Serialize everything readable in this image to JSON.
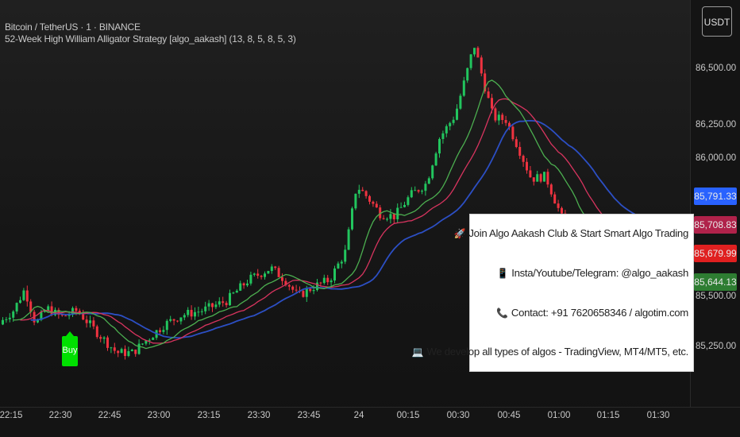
{
  "header": {
    "symbol_line": "Bitcoin / TetherUS · 1 · BINANCE",
    "indicator_line": "52-Week High William Alligator Strategy [algo_aakash] (13, 8, 5, 8, 5, 3)"
  },
  "currency_button": "USDT",
  "price_axis": {
    "labels": [
      "86,500.00",
      "86,250.00",
      "86,000.00",
      "85,500.00",
      "85,250.00"
    ],
    "badges": [
      {
        "text": "85,791.33",
        "color": "#2962ff"
      },
      {
        "text": "85,708.83",
        "color": "#b0224a"
      },
      {
        "text": "85,679.99",
        "color": "#e02020"
      },
      {
        "text": "85,644.13",
        "color": "#2e7d32"
      }
    ]
  },
  "time_axis": {
    "labels": [
      "22:15",
      "22:30",
      "22:45",
      "23:00",
      "23:15",
      "23:30",
      "23:45",
      "24",
      "00:15",
      "00:30",
      "00:45",
      "01:00",
      "01:15",
      "01:30"
    ]
  },
  "info_box": {
    "lines": [
      {
        "icon": "rocket-icon",
        "glyph": "🚀",
        "text": "Join Algo Aakash Club & Start Smart Algo Trading"
      },
      {
        "icon": "phone-icon",
        "glyph": "📱",
        "text": "Insta/Youtube/Telegram: @algo_aakash"
      },
      {
        "icon": "telephone-icon",
        "glyph": "📞",
        "text": "Contact: +91 7620658346 / algotim.com"
      },
      {
        "icon": "computer-icon",
        "glyph": "💻",
        "text": "We develop all types of algos - TradingView, MT4/MT5, etc."
      }
    ]
  },
  "buy_marker": {
    "text": "Buy",
    "color": "#00e000"
  },
  "chart_data": {
    "type": "candlestick",
    "ylim": [
      85150,
      86650
    ],
    "up_color": "#22c55e",
    "down_color": "#ef3340",
    "lines": [
      {
        "name": "jaw",
        "color": "#2c4fc4"
      },
      {
        "name": "teeth",
        "color": "#d8345f"
      },
      {
        "name": "lips",
        "color": "#4caf50"
      }
    ],
    "anchors": [
      [
        0,
        85410
      ],
      [
        20,
        85470
      ],
      [
        34,
        85560
      ],
      [
        48,
        85410
      ],
      [
        62,
        85480
      ],
      [
        80,
        85440
      ],
      [
        100,
        85470
      ],
      [
        124,
        85380
      ],
      [
        150,
        85290
      ],
      [
        170,
        85290
      ],
      [
        186,
        85340
      ],
      [
        210,
        85410
      ],
      [
        232,
        85450
      ],
      [
        258,
        85470
      ],
      [
        288,
        85510
      ],
      [
        316,
        85600
      ],
      [
        344,
        85650
      ],
      [
        362,
        85600
      ],
      [
        378,
        85530
      ],
      [
        398,
        85570
      ],
      [
        418,
        85600
      ],
      [
        438,
        85720
      ],
      [
        452,
        86000
      ],
      [
        466,
        85950
      ],
      [
        482,
        85880
      ],
      [
        500,
        85870
      ],
      [
        520,
        85960
      ],
      [
        540,
        86010
      ],
      [
        556,
        86200
      ],
      [
        576,
        86300
      ],
      [
        590,
        86470
      ],
      [
        600,
        86600
      ],
      [
        612,
        86440
      ],
      [
        624,
        86290
      ],
      [
        640,
        86280
      ],
      [
        656,
        86160
      ],
      [
        672,
        86030
      ],
      [
        690,
        86040
      ],
      [
        704,
        85920
      ],
      [
        720,
        85780
      ],
      [
        742,
        85730
      ],
      [
        762,
        85770
      ],
      [
        780,
        85760
      ],
      [
        800,
        85720
      ],
      [
        820,
        85700
      ],
      [
        840,
        85650
      ],
      [
        855,
        85630
      ],
      [
        866,
        85680
      ]
    ]
  }
}
